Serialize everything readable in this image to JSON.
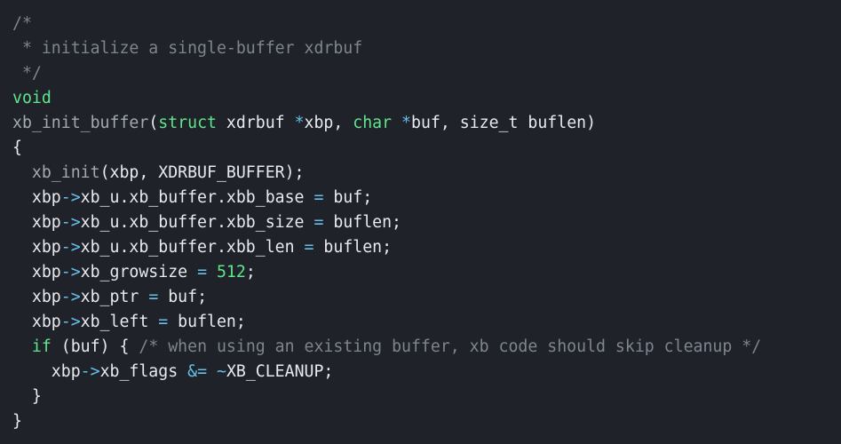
{
  "code": {
    "language": "c",
    "lines": [
      [
        {
          "t": "/*",
          "k": "comment"
        }
      ],
      [
        {
          "t": " * initialize a single-buffer xdrbuf",
          "k": "comment"
        }
      ],
      [
        {
          "t": " */",
          "k": "comment"
        }
      ],
      [
        {
          "t": "void",
          "k": "keyword"
        }
      ],
      [
        {
          "t": "xb_init_buffer",
          "k": "func"
        },
        {
          "t": "(",
          "k": "text"
        },
        {
          "t": "struct",
          "k": "keyword"
        },
        {
          "t": " xdrbuf ",
          "k": "text"
        },
        {
          "t": "*",
          "k": "op"
        },
        {
          "t": "xbp, ",
          "k": "text"
        },
        {
          "t": "char",
          "k": "keyword"
        },
        {
          "t": " ",
          "k": "text"
        },
        {
          "t": "*",
          "k": "op"
        },
        {
          "t": "buf, size_t buflen)",
          "k": "text"
        }
      ],
      [
        {
          "t": "{",
          "k": "text"
        }
      ],
      [
        {
          "t": "  ",
          "k": "text"
        },
        {
          "t": "xb_init",
          "k": "func"
        },
        {
          "t": "(xbp, XDRBUF_BUFFER);",
          "k": "text"
        }
      ],
      [
        {
          "t": "  xbp",
          "k": "text"
        },
        {
          "t": "->",
          "k": "op"
        },
        {
          "t": "xb_u.xb_buffer.xbb_base ",
          "k": "text"
        },
        {
          "t": "=",
          "k": "op"
        },
        {
          "t": " buf;",
          "k": "text"
        }
      ],
      [
        {
          "t": "  xbp",
          "k": "text"
        },
        {
          "t": "->",
          "k": "op"
        },
        {
          "t": "xb_u.xb_buffer.xbb_size ",
          "k": "text"
        },
        {
          "t": "=",
          "k": "op"
        },
        {
          "t": " buflen;",
          "k": "text"
        }
      ],
      [
        {
          "t": "  xbp",
          "k": "text"
        },
        {
          "t": "->",
          "k": "op"
        },
        {
          "t": "xb_u.xb_buffer.xbb_len ",
          "k": "text"
        },
        {
          "t": "=",
          "k": "op"
        },
        {
          "t": " buflen;",
          "k": "text"
        }
      ],
      [
        {
          "t": "  xbp",
          "k": "text"
        },
        {
          "t": "->",
          "k": "op"
        },
        {
          "t": "xb_growsize ",
          "k": "text"
        },
        {
          "t": "=",
          "k": "op"
        },
        {
          "t": " ",
          "k": "text"
        },
        {
          "t": "512",
          "k": "num"
        },
        {
          "t": ";",
          "k": "text"
        }
      ],
      [
        {
          "t": "  xbp",
          "k": "text"
        },
        {
          "t": "->",
          "k": "op"
        },
        {
          "t": "xb_ptr ",
          "k": "text"
        },
        {
          "t": "=",
          "k": "op"
        },
        {
          "t": " buf;",
          "k": "text"
        }
      ],
      [
        {
          "t": "  xbp",
          "k": "text"
        },
        {
          "t": "->",
          "k": "op"
        },
        {
          "t": "xb_left ",
          "k": "text"
        },
        {
          "t": "=",
          "k": "op"
        },
        {
          "t": " buflen;",
          "k": "text"
        }
      ],
      [
        {
          "t": "  ",
          "k": "text"
        },
        {
          "t": "if",
          "k": "keyword"
        },
        {
          "t": " (buf) { ",
          "k": "text"
        },
        {
          "t": "/* when using an existing buffer, xb code should skip cleanup */",
          "k": "comment"
        }
      ],
      [
        {
          "t": "    xbp",
          "k": "text"
        },
        {
          "t": "->",
          "k": "op"
        },
        {
          "t": "xb_flags ",
          "k": "text"
        },
        {
          "t": "&=",
          "k": "op"
        },
        {
          "t": " ",
          "k": "text"
        },
        {
          "t": "~",
          "k": "op"
        },
        {
          "t": "XB_CLEANUP;",
          "k": "text"
        }
      ],
      [
        {
          "t": "  }",
          "k": "text"
        }
      ],
      [
        {
          "t": "}",
          "k": "text"
        }
      ]
    ]
  },
  "colors": {
    "background": "#1f2329",
    "text": "#e7eaee",
    "comment": "#7e858e",
    "keyword": "#5fe58c",
    "operator": "#66c0ea",
    "function": "#a3a9b0"
  }
}
